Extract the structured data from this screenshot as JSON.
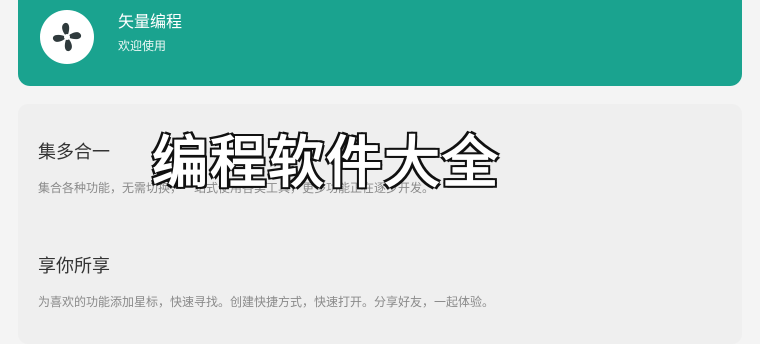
{
  "header": {
    "icon": "fan-icon",
    "title": "矢量编程",
    "subtitle": "欢迎使用",
    "accent": "#1aa38f"
  },
  "sections": [
    {
      "title": "集多合一",
      "description": "集合各种功能，无需切换，一站式使用各类工具，更多功能正在逐步开发。"
    },
    {
      "title": "享你所享",
      "description": "为喜欢的功能添加星标，快速寻找。创建快捷方式，快速打开。分享好友，一起体验。"
    }
  ],
  "overlay_text": "编程软件大全"
}
